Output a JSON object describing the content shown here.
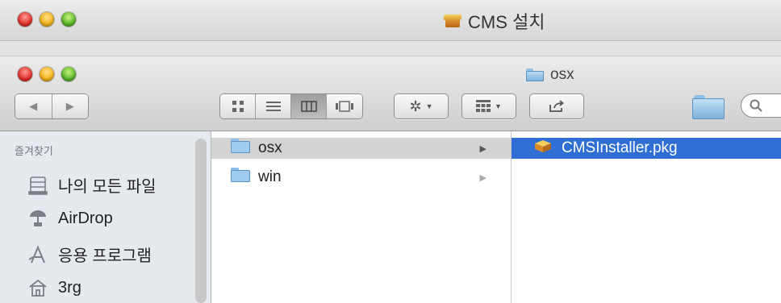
{
  "outer_window": {
    "title": "CMS 설치",
    "title_icon": "package-icon"
  },
  "finder": {
    "title": "osx",
    "title_icon": "folder-icon",
    "toolbar": {
      "nav_back_icon": "chevron-left-icon",
      "nav_forward_icon": "chevron-right-icon",
      "view_modes": [
        "icon-view",
        "list-view",
        "column-view",
        "coverflow-view"
      ],
      "active_view": "column-view",
      "action_icon": "gear-icon",
      "arrange_icon": "grid-arrange-icon",
      "share_icon": "share-icon",
      "search_placeholder": ""
    },
    "sidebar": {
      "header": "즐겨찾기",
      "items": [
        {
          "label": "나의 모든 파일",
          "icon": "all-files-icon"
        },
        {
          "label": "AirDrop",
          "icon": "airdrop-icon"
        },
        {
          "label": "응용 프로그램",
          "icon": "applications-icon"
        },
        {
          "label": "3rg",
          "icon": "home-icon"
        }
      ]
    },
    "column1": {
      "items": [
        {
          "name": "osx",
          "selected": true
        },
        {
          "name": "win",
          "selected": false
        }
      ]
    },
    "column2": {
      "items": [
        {
          "name": "CMSInstaller.pkg",
          "selected": true
        }
      ]
    }
  },
  "colors": {
    "selection_blue": "#2f6fd4",
    "selection_gray": "#d3d3d3",
    "sidebar_bg": "#e6eaef"
  }
}
